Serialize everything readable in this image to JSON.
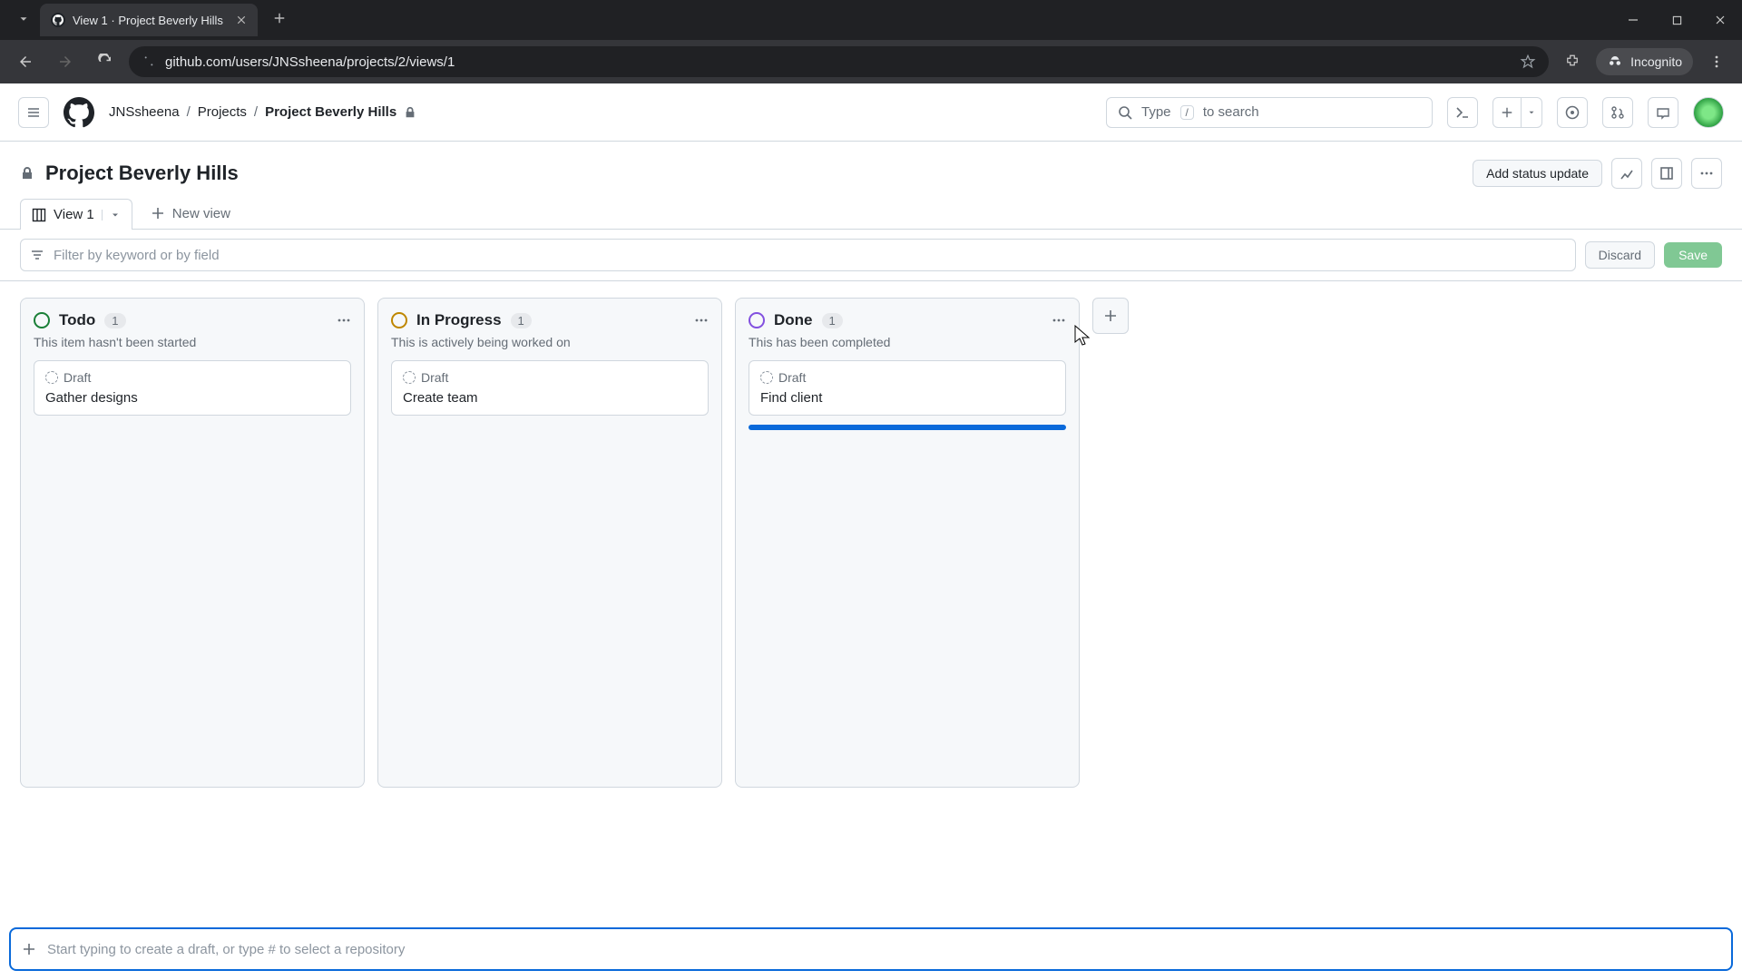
{
  "browser": {
    "tab_title": "View 1 · Project Beverly Hills",
    "url": "github.com/users/JNSsheena/projects/2/views/1",
    "incognito_label": "Incognito"
  },
  "header": {
    "search_placeholder": "Type",
    "search_hint_after": "to search",
    "search_kbd": "/"
  },
  "breadcrumbs": {
    "user": "JNSsheena",
    "projects": "Projects",
    "project": "Project Beverly Hills"
  },
  "project": {
    "title": "Project Beverly Hills",
    "add_status_label": "Add status update"
  },
  "views": {
    "current": "View 1",
    "new_view_label": "New view"
  },
  "filter": {
    "placeholder": "Filter by keyword or by field",
    "discard": "Discard",
    "save": "Save"
  },
  "columns": [
    {
      "title": "Todo",
      "count": "1",
      "desc": "This item hasn't been started",
      "color": "green",
      "cards": [
        {
          "badge": "Draft",
          "title": "Gather designs"
        }
      ],
      "drop": false
    },
    {
      "title": "In Progress",
      "count": "1",
      "desc": "This is actively being worked on",
      "color": "yellow",
      "cards": [
        {
          "badge": "Draft",
          "title": "Create team"
        }
      ],
      "drop": false
    },
    {
      "title": "Done",
      "count": "1",
      "desc": "This has been completed",
      "color": "purple",
      "cards": [
        {
          "badge": "Draft",
          "title": "Find client"
        }
      ],
      "drop": true
    }
  ],
  "bottom_input": {
    "placeholder": "Start typing to create a draft, or type # to select a repository"
  }
}
